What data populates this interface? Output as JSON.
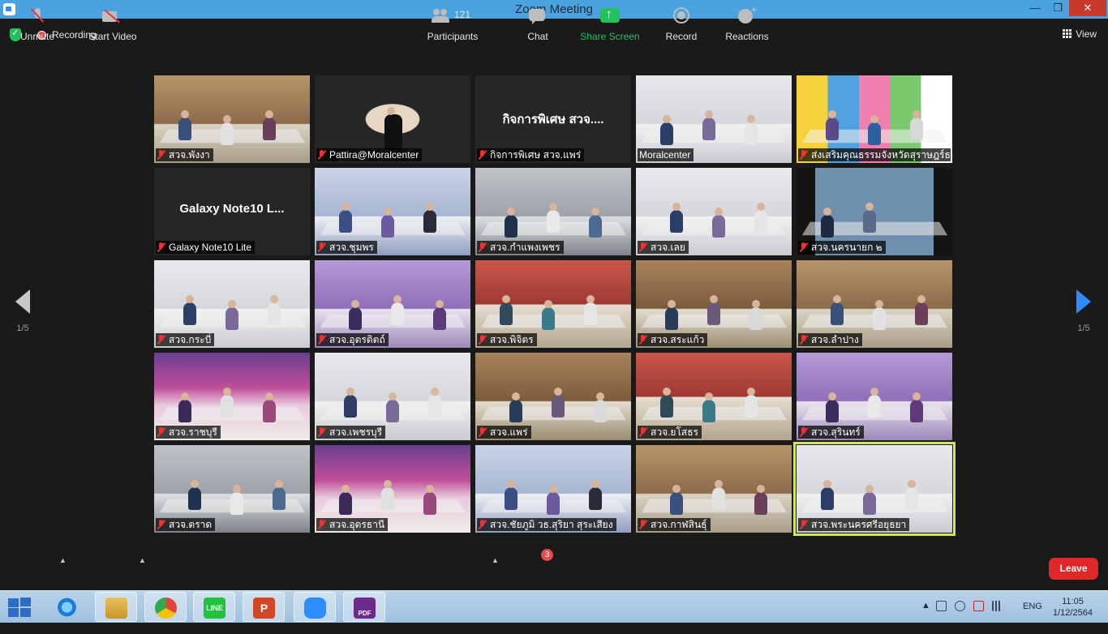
{
  "window": {
    "title": "Zoom Meeting"
  },
  "topbar": {
    "recording_label": "Recording",
    "view_label": "View"
  },
  "pager": {
    "left_page": "1/5",
    "right_page": "1/5"
  },
  "tiles": [
    {
      "label": "สวจ.พังงา",
      "muted": true,
      "theme": "room-warm"
    },
    {
      "label": "Pattira@Moralcenter",
      "muted": true,
      "theme": "portrait"
    },
    {
      "label": "กิจการพิเศษ สวจ.แพร่",
      "muted": true,
      "theme": "name",
      "display_name": "กิจการพิเศษ สวจ...."
    },
    {
      "label": "Moralcenter",
      "muted": false,
      "theme": "room-white"
    },
    {
      "label": "ส่งเสริมคุณธรรมจังหวัดสุราษฎร์ธานี",
      "muted": true,
      "theme": "room-colorful"
    },
    {
      "label": "Galaxy Note10 Lite",
      "muted": true,
      "theme": "name",
      "display_name": "Galaxy Note10 L..."
    },
    {
      "label": "สวจ.ชุมพร",
      "muted": true,
      "theme": "room-blue"
    },
    {
      "label": "สวจ.กำแพงเพชร",
      "muted": true,
      "theme": "room-gray"
    },
    {
      "label": "สวจ.เลย",
      "muted": true,
      "theme": "room-white"
    },
    {
      "label": "สวจ.นครนายก ๒",
      "muted": true,
      "theme": "closeup"
    },
    {
      "label": "สวจ.กระบี่",
      "muted": true,
      "theme": "room-white"
    },
    {
      "label": "สวจ.อุตรดิตถ์",
      "muted": true,
      "theme": "room-purple"
    },
    {
      "label": "สวจ.พิจิตร",
      "muted": true,
      "theme": "room-red"
    },
    {
      "label": "สวจ.สระแก้ว",
      "muted": true,
      "theme": "room-wood"
    },
    {
      "label": "สวจ.ลำปาง",
      "muted": true,
      "theme": "room-warm"
    },
    {
      "label": "สวจ.ราชบุรี",
      "muted": true,
      "theme": "room-banner"
    },
    {
      "label": "สวจ.เพชรบุรี",
      "muted": true,
      "theme": "room-white"
    },
    {
      "label": "สวจ.แพร่",
      "muted": true,
      "theme": "room-wood"
    },
    {
      "label": "สวจ.ยโสธร",
      "muted": true,
      "theme": "room-red"
    },
    {
      "label": "สวจ.สุรินทร์",
      "muted": true,
      "theme": "room-purple"
    },
    {
      "label": "สวจ.ตราด",
      "muted": true,
      "theme": "room-gray"
    },
    {
      "label": "สวจ.อุดรธานี",
      "muted": true,
      "theme": "room-banner"
    },
    {
      "label": "สวจ.ชัยภูมิ วธ.สุริยา สุระเสียง",
      "muted": true,
      "theme": "room-blue"
    },
    {
      "label": "สวจ.กาฬสินธุ์",
      "muted": true,
      "theme": "room-warm"
    },
    {
      "label": "สวจ.พระนครศรีอยุธยา",
      "muted": true,
      "theme": "room-white",
      "active": true
    }
  ],
  "toolbar": {
    "unmute_label": "Unmute",
    "start_video_label": "Start Video",
    "participants_label": "Participants",
    "participants_count": "121",
    "chat_label": "Chat",
    "chat_badge": "3",
    "share_label": "Share Screen",
    "record_label": "Record",
    "reactions_label": "Reactions",
    "leave_label": "Leave"
  },
  "taskbar": {
    "apps": [
      "windows-start",
      "internet-explorer",
      "file-explorer",
      "chrome",
      "line",
      "powerpoint",
      "zoom",
      "pdf-app"
    ],
    "language": "ENG",
    "time": "11:05",
    "date": "1/12/2564"
  },
  "colors": {
    "titlebar": "#4aa3df",
    "active_speaker_border": "#cfe85a",
    "share_green": "#23c15c",
    "leave_red": "#e02828",
    "nav_blue": "#2d8cff"
  }
}
